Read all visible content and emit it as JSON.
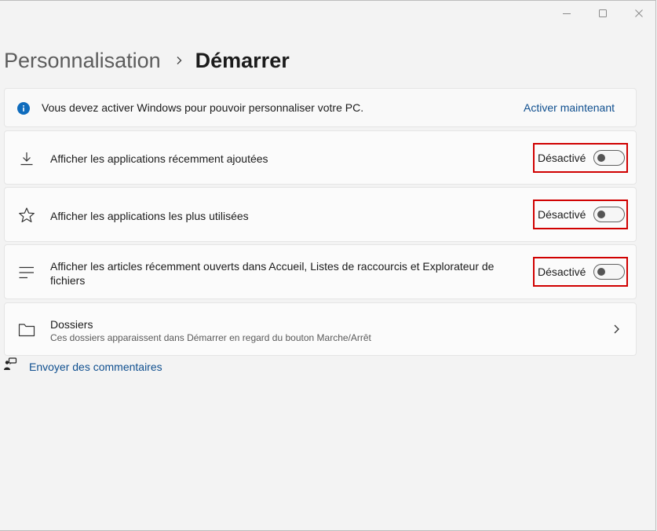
{
  "window": {
    "minimize_icon": "minimize-icon",
    "maximize_icon": "maximize-icon",
    "close_icon": "close-icon"
  },
  "breadcrumb": {
    "parent": "Personnalisation",
    "current": "Démarrer"
  },
  "activation_banner": {
    "icon": "info-icon",
    "message": "Vous devez activer Windows pour pouvoir personnaliser votre PC.",
    "link": "Activer maintenant"
  },
  "settings": [
    {
      "icon": "download-icon",
      "title": "Afficher les applications récemment ajoutées",
      "state_label": "Désactivé",
      "on": false
    },
    {
      "icon": "star-icon",
      "title": "Afficher les applications les plus utilisées",
      "state_label": "Désactivé",
      "on": false
    },
    {
      "icon": "list-icon",
      "title": "Afficher les articles récemment ouverts dans Accueil, Listes de raccourcis et Explorateur de fichiers",
      "state_label": "Désactivé",
      "on": false
    }
  ],
  "folders": {
    "icon": "folder-icon",
    "title": "Dossiers",
    "subtitle": "Ces dossiers apparaissent dans Démarrer en regard du bouton Marche/Arrêt"
  },
  "feedback": {
    "icon": "feedback-icon",
    "label": "Envoyer des commentaires"
  },
  "colors": {
    "accent": "#0f6cbd",
    "link": "#0f4f8f",
    "highlight_box": "#d00000"
  }
}
